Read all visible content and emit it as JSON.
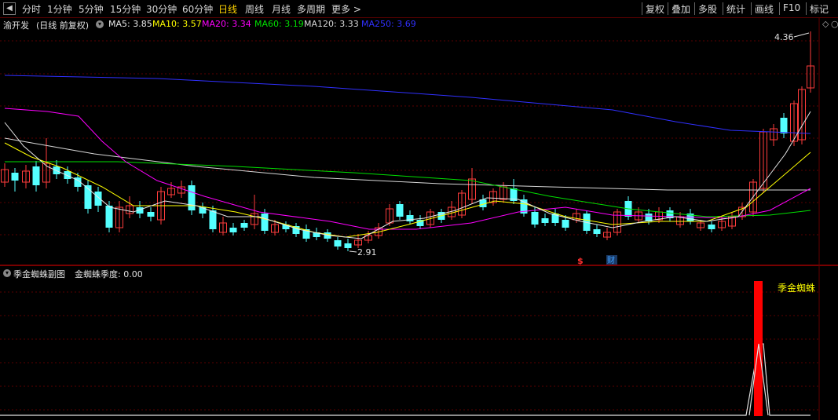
{
  "toolbar": {
    "left_items": [
      {
        "label": "分时",
        "active": false
      },
      {
        "label": "1分钟",
        "active": false
      },
      {
        "label": "5分钟",
        "active": false
      },
      {
        "label": "15分钟",
        "active": false
      },
      {
        "label": "30分钟",
        "active": false
      },
      {
        "label": "60分钟",
        "active": false
      },
      {
        "label": "日线",
        "active": true
      },
      {
        "label": "周线",
        "active": false
      },
      {
        "label": "月线",
        "active": false
      },
      {
        "label": "多周期",
        "active": false
      },
      {
        "label": "更多",
        "active": false
      }
    ],
    "right_items": [
      "复权",
      "叠加",
      "多股",
      "统计",
      "画线",
      "F10",
      "标记"
    ]
  },
  "main_chart": {
    "stock_name": "渝开发",
    "mode": "(日线 前复权)",
    "ma_labels": [
      {
        "label": "MA5: 3.85",
        "color": "#e8e8e8"
      },
      {
        "label": "MA10: 3.57",
        "color": "#ffff00"
      },
      {
        "label": "MA20: 3.34",
        "color": "#ff00ff"
      },
      {
        "label": "MA60: 3.19",
        "color": "#00e000"
      },
      {
        "label": "MA120: 3.33",
        "color": "#d8d8d8"
      },
      {
        "label": "MA250: 3.69",
        "color": "#3030ff"
      }
    ],
    "high_label": "4.36",
    "low_label": "2.91",
    "event_markers": [
      {
        "label": "$",
        "color": "#ff3030"
      },
      {
        "label": "财",
        "color": "#40a0ff"
      }
    ]
  },
  "sub_chart": {
    "title": "季金蜘蛛副图",
    "value_label": "金蜘蛛季度: 0.00",
    "legend": "季金蜘蛛",
    "colors": {
      "bar": "#ff0000",
      "legend": "#ffff00"
    }
  },
  "colors": {
    "up": "#ff3c3c",
    "down": "#54ffff",
    "grid": "#5a0000"
  }
}
